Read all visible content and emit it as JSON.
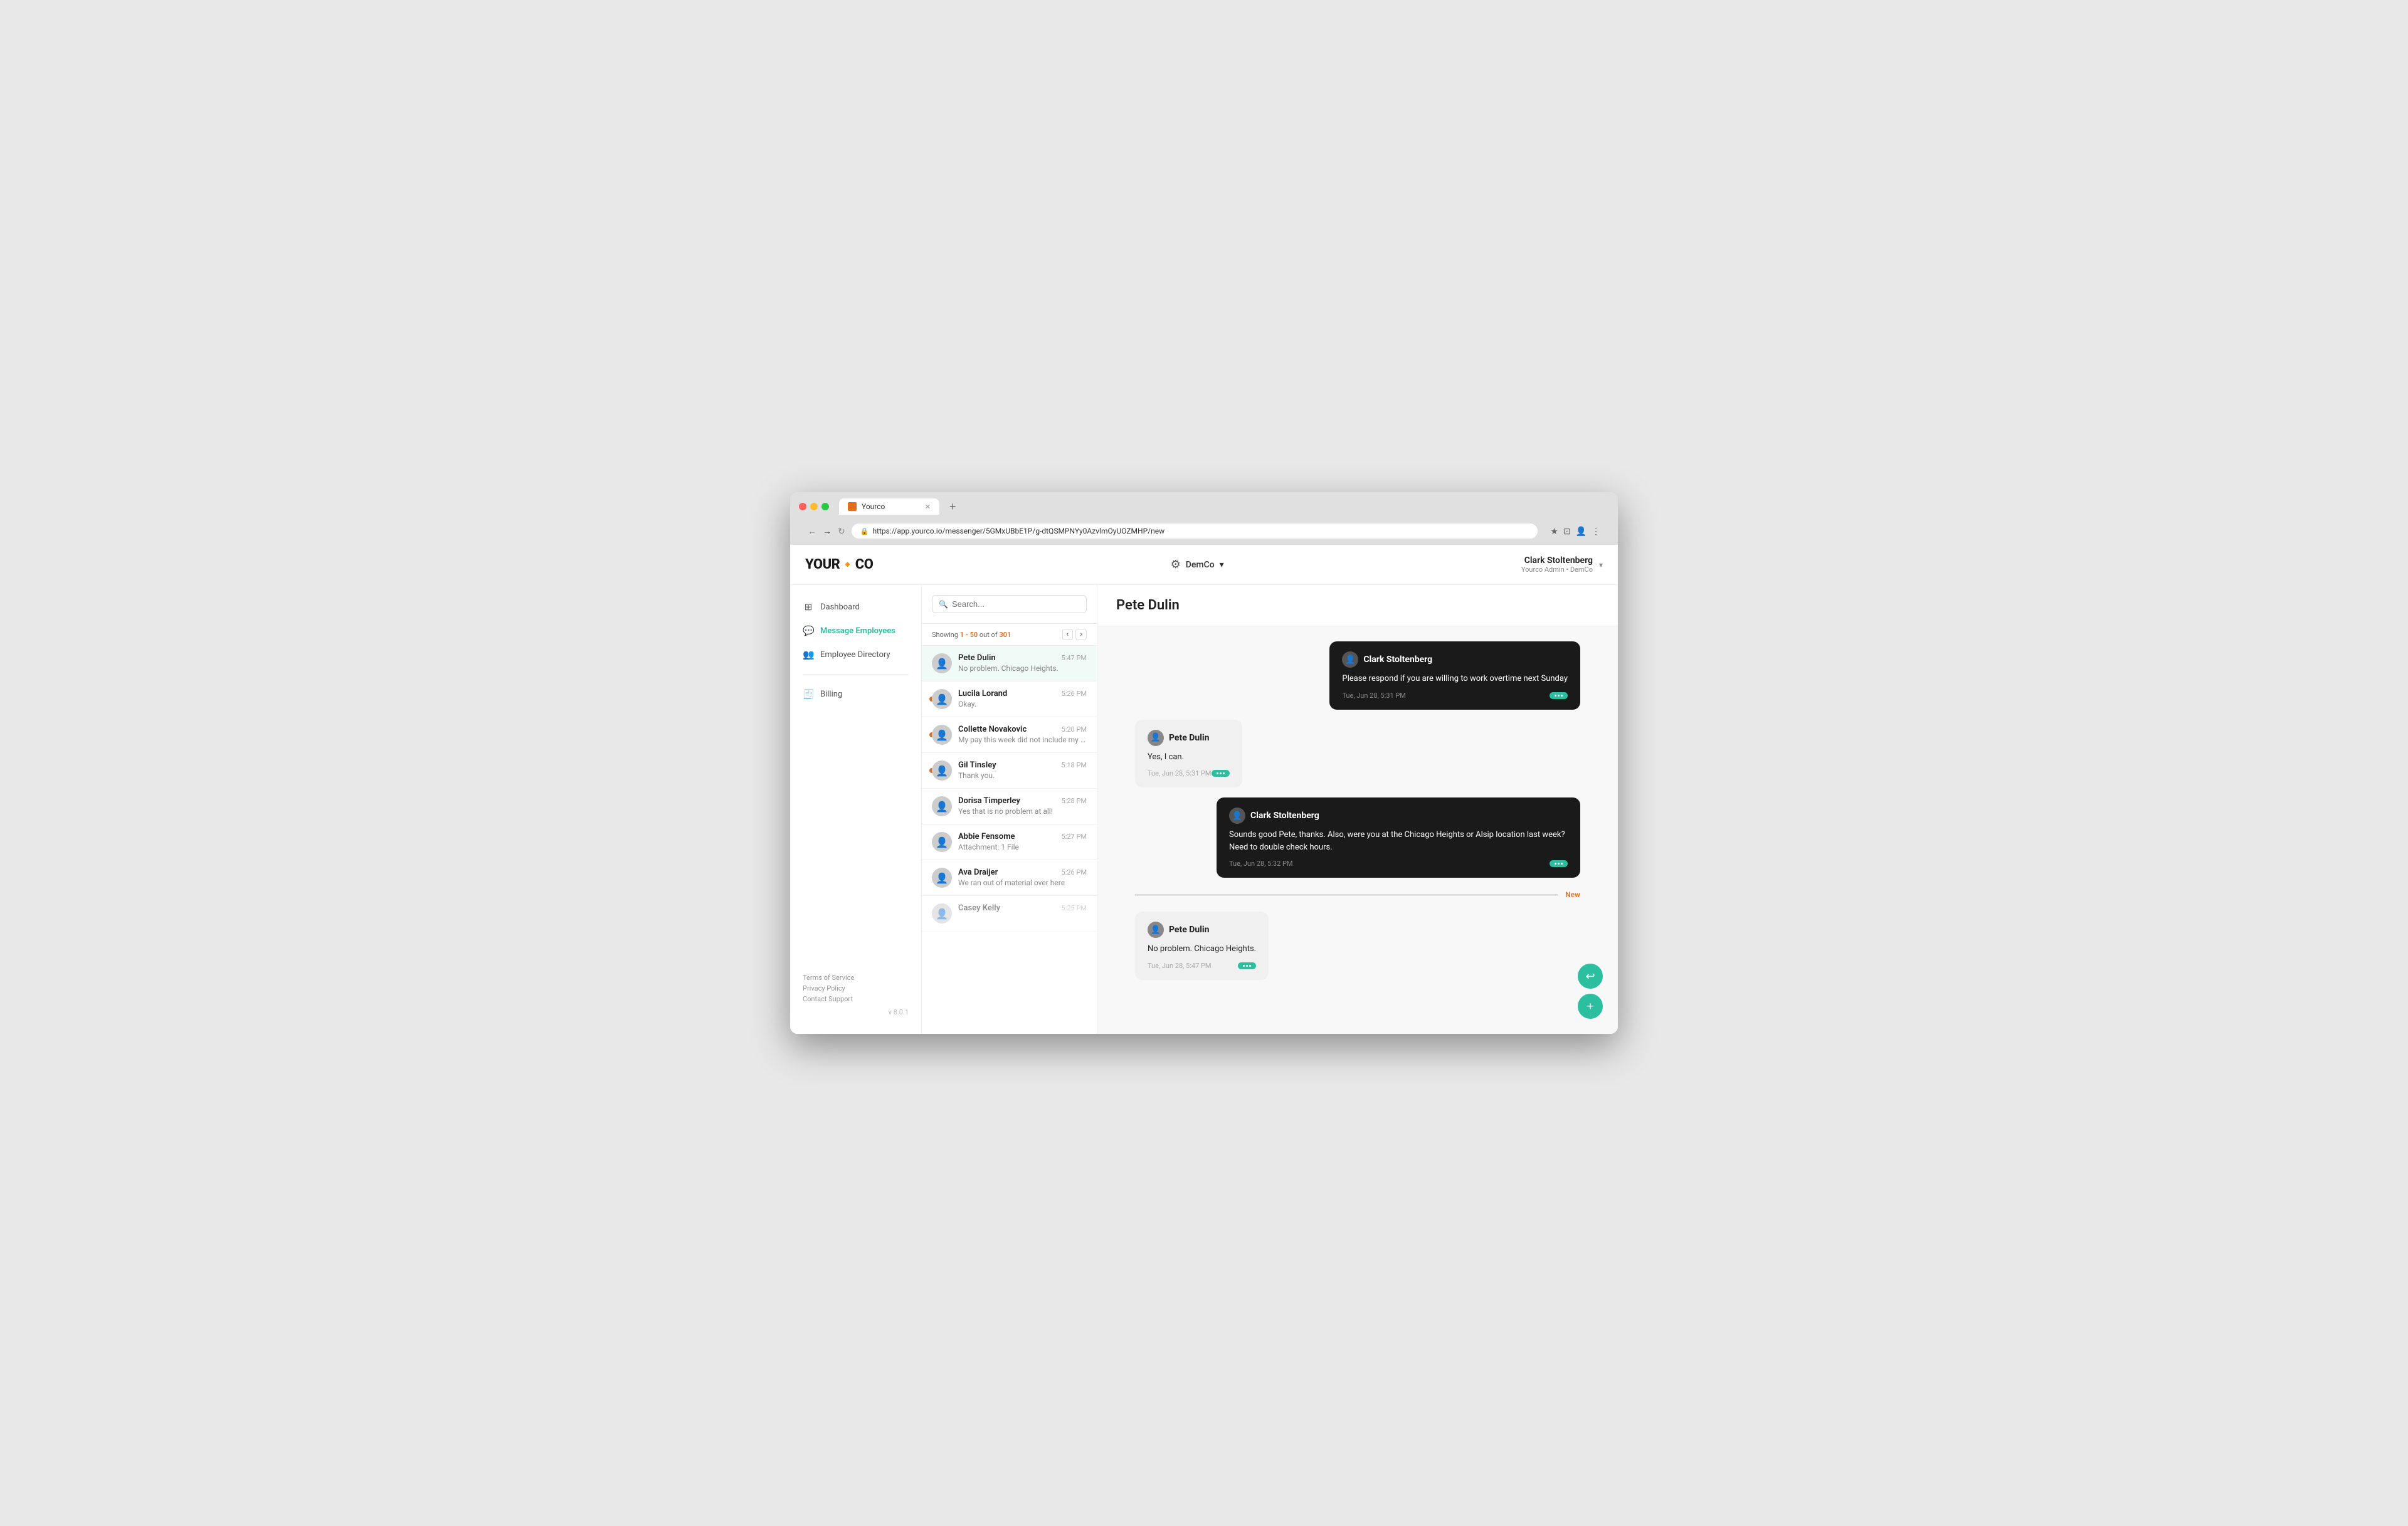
{
  "browser": {
    "tab_label": "Yourco",
    "url": "https://app.yourco.io/messenger/5GMxUBbE1P/g-dtQSMPNYy0AzvlmOyUOZMHP/new",
    "new_tab_label": "+"
  },
  "header": {
    "logo": "YOUR",
    "logo_dot": "🟠",
    "logo_text": "CO",
    "company": "DemCo",
    "company_chevron": "▾",
    "user_name": "Clark Stoltenberg",
    "user_role": "Yourco Admin • DemCo",
    "user_chevron": "▾"
  },
  "sidebar": {
    "items": [
      {
        "id": "dashboard",
        "label": "Dashboard",
        "icon": "⊞"
      },
      {
        "id": "message-employees",
        "label": "Message Employees",
        "icon": "💬",
        "active": true
      },
      {
        "id": "employee-directory",
        "label": "Employee Directory",
        "icon": "👥"
      }
    ],
    "billing_label": "Billing",
    "billing_icon": "🧾",
    "footer_links": [
      "Terms of Service",
      "Privacy Policy",
      "Contact Support"
    ],
    "version": "v 8.0.1"
  },
  "conversation_list": {
    "search_placeholder": "Search...",
    "showing_text": "Showing ",
    "showing_range": "1 - 50",
    "showing_out_of": " out of ",
    "showing_count": "301",
    "conversations": [
      {
        "id": 1,
        "name": "Pete Dulin",
        "time": "5:47 PM",
        "preview": "No problem. Chicago Heights.",
        "unread": false,
        "active": true
      },
      {
        "id": 2,
        "name": "Lucila Lorand",
        "time": "5:26 PM",
        "preview": "Okay.",
        "unread": true,
        "active": false
      },
      {
        "id": 3,
        "name": "Collette Novakovic",
        "time": "5:20 PM",
        "preview": "My pay this week did not include my overtime.",
        "unread": true,
        "active": false
      },
      {
        "id": 4,
        "name": "Gil Tinsley",
        "time": "5:18 PM",
        "preview": "Thank you.",
        "unread": true,
        "active": false
      },
      {
        "id": 5,
        "name": "Dorisa Timperley",
        "time": "5:28 PM",
        "preview": "Yes that is no problem at all!",
        "unread": false,
        "active": false
      },
      {
        "id": 6,
        "name": "Abbie Fensome",
        "time": "5:27 PM",
        "preview": "Attachment: 1 File",
        "unread": false,
        "active": false
      },
      {
        "id": 7,
        "name": "Ava Draijer",
        "time": "5:26 PM",
        "preview": "We ran out of material over here",
        "unread": false,
        "active": false
      },
      {
        "id": 8,
        "name": "Casey Kelly",
        "time": "5:25 PM",
        "preview": "",
        "unread": false,
        "active": false
      }
    ]
  },
  "chat": {
    "title": "Pete Dulin",
    "messages": [
      {
        "id": 1,
        "type": "admin",
        "sender": "Clark Stoltenberg",
        "text": "Please respond if you are willing to work overtime next Sunday",
        "time": "Tue, Jun 28, 5:31 PM",
        "new_marker": false
      },
      {
        "id": 2,
        "type": "employee",
        "sender": "Pete Dulin",
        "text": "Yes, I can.",
        "time": "Tue, Jun 28, 5:31 PM",
        "new_marker": false
      },
      {
        "id": 3,
        "type": "admin",
        "sender": "Clark Stoltenberg",
        "text": "Sounds good Pete, thanks. Also, were you at the Chicago Heights or Alsip location last week? Need to double check hours.",
        "time": "Tue, Jun 28, 5:32 PM",
        "new_marker": false
      },
      {
        "id": 4,
        "type": "employee",
        "sender": "Pete Dulin",
        "text": "No problem. Chicago Heights.",
        "time": "Tue, Jun 28, 5:47 PM",
        "new_marker": true
      }
    ],
    "new_label": "New",
    "fab_reply": "↩",
    "fab_add": "+"
  }
}
